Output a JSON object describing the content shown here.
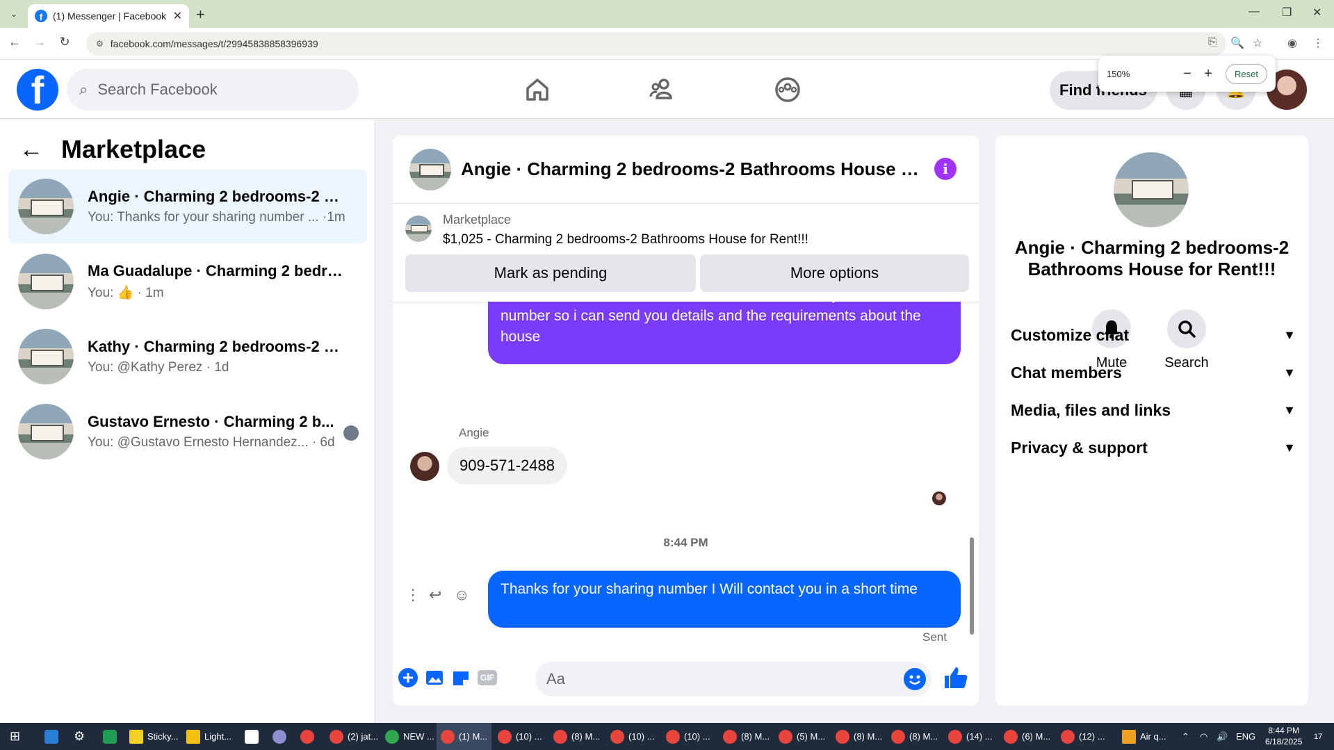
{
  "browser": {
    "tab_title": "(1) Messenger | Facebook",
    "url": "facebook.com/messages/t/29945838858396939",
    "zoom": {
      "value": "150%",
      "reset_label": "Reset"
    }
  },
  "header": {
    "search_placeholder": "Search Facebook",
    "find_friends_label": "Find friends"
  },
  "sidebar": {
    "title": "Marketplace",
    "conversations": [
      {
        "name": "Angie · Charming 2 bedrooms-2 B...",
        "preview": "You: Thanks for your sharing number ... ·1m",
        "active": true
      },
      {
        "name": "Ma Guadalupe · Charming 2 bedro...",
        "preview": "You: 👍 · 1m",
        "active": false
      },
      {
        "name": "Kathy · Charming 2 bedrooms-2 B...",
        "preview": "You: @Kathy Perez · 1d",
        "active": false
      },
      {
        "name": "Gustavo Ernesto · Charming 2 b...",
        "preview": "You: @Gustavo Ernesto Hernandez... · 6d",
        "active": false
      }
    ]
  },
  "chat": {
    "title": "Angie · Charming 2 bedrooms-2 Bathrooms House for ...",
    "listing": {
      "category": "Marketplace",
      "title": "$1,025 - Charming 2 bedrooms-2 Bathrooms House for Rent!!!",
      "mark_pending_label": "Mark as pending",
      "more_options_label": "More options"
    },
    "messages": [
      {
        "from": "me",
        "text": "Yes the house is still available for rent, let me have your contact number so i can send you details and the requirements about the house"
      },
      {
        "from": "Angie",
        "sender_label": "Angie",
        "text": "909-571-2488"
      },
      {
        "from": "me",
        "text": "Thanks for your sharing number I Will contact you in  a short time"
      }
    ],
    "timestamp": "8:44 PM",
    "status": "Sent",
    "composer_placeholder": "Aa",
    "gif_label": "GIF"
  },
  "details": {
    "title": "Angie · Charming 2 bedrooms-2 Bathrooms House for Rent!!!",
    "actions": {
      "mute_label": "Mute",
      "search_label": "Search"
    },
    "sections": [
      "Customize chat",
      "Chat members",
      "Media, files and links",
      "Privacy & support"
    ]
  },
  "taskbar": {
    "items": [
      "Sticky...",
      "Light...",
      "(2) jat...",
      "NEW ...",
      "(1) M...",
      "(10) ...",
      "(8) M...",
      "(10) ...",
      "(10) ...",
      "(8) M...",
      "(5) M...",
      "(8) M...",
      "(8) M...",
      "(14) ...",
      "(6) M...",
      "(12) ..."
    ],
    "weather": "Air q...",
    "language": "ENG",
    "time": "8:44 PM",
    "date": "6/18/2025",
    "notifications": "17"
  },
  "colors": {
    "facebook_blue": "#0866ff",
    "purple_bubble": "#7b3cfa",
    "info_purple": "#a033ff",
    "chrome_green": "#d3e3c8"
  }
}
